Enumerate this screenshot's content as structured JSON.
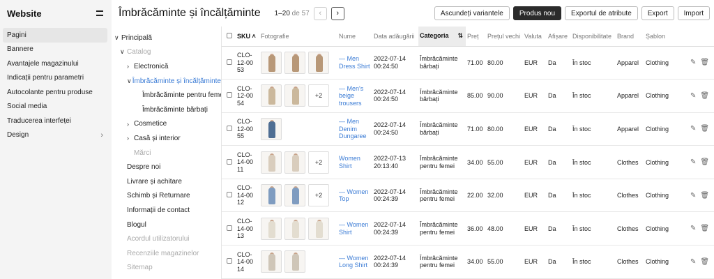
{
  "nav": {
    "title": "Website",
    "items": [
      {
        "label": "Pagini",
        "active": true
      },
      {
        "label": "Bannere"
      },
      {
        "label": "Avantajele magazinului"
      },
      {
        "label": "Indicații pentru parametri"
      },
      {
        "label": "Autocolante pentru produse"
      },
      {
        "label": "Social media"
      },
      {
        "label": "Traducerea interfeței"
      },
      {
        "label": "Design",
        "chevron": "›"
      }
    ]
  },
  "tree": [
    {
      "label": "Principală",
      "arrow": "∨",
      "indent": 0
    },
    {
      "label": "Catalog",
      "arrow": "∨",
      "indent": 1,
      "muted": true
    },
    {
      "label": "Electronică",
      "arrow": "›",
      "indent": 2
    },
    {
      "label": "Îmbrăcăminte și încălțăminte",
      "arrow": "∨",
      "indent": 2,
      "link": true
    },
    {
      "label": "Îmbrăcăminte pentru femei",
      "arrow": "",
      "indent": 3
    },
    {
      "label": "Îmbrăcăminte bărbați",
      "arrow": "",
      "indent": 3
    },
    {
      "label": "Cosmetice",
      "arrow": "›",
      "indent": 2
    },
    {
      "label": "Casă și interior",
      "arrow": "›",
      "indent": 2
    },
    {
      "label": "Mărci",
      "arrow": "",
      "indent": 2,
      "muted": true
    },
    {
      "label": "Despre noi",
      "arrow": "",
      "indent": 1
    },
    {
      "label": "Livrare și achitare",
      "arrow": "",
      "indent": 1
    },
    {
      "label": "Schimb și Returnare",
      "arrow": "",
      "indent": 1
    },
    {
      "label": "Informații de contact",
      "arrow": "",
      "indent": 1
    },
    {
      "label": "Blogul",
      "arrow": "",
      "indent": 1
    },
    {
      "label": "Acordul utilizatorului",
      "arrow": "",
      "indent": 1,
      "muted": true
    },
    {
      "label": "Recenziile magazinelor",
      "arrow": "",
      "indent": 1,
      "muted": true
    },
    {
      "label": "Sitemap",
      "arrow": "",
      "indent": 1,
      "muted": true
    }
  ],
  "header": {
    "title": "Îmbrăcăminte și încălțăminte",
    "range": "1–20",
    "of": "de 57",
    "prev_icon": "chevron-left-icon",
    "next_icon": "chevron-right-icon",
    "buttons": {
      "hide_variants": "Ascundeți variantele",
      "new_product": "Produs nou",
      "export_attributes": "Exportul de atribute",
      "export": "Export",
      "import": "Import"
    }
  },
  "table": {
    "columns": {
      "sku": "SKU",
      "photo": "Fotografie",
      "name": "Nume",
      "date": "Data adăugării",
      "category": "Categoria",
      "price": "Preț",
      "old_price": "Prețul vechi",
      "currency": "Valuta",
      "display": "Afișare",
      "availability": "Disponibilitate",
      "brand": "Brand",
      "template": "Șablon"
    },
    "rows": [
      {
        "sku": "CLO-12-0053",
        "photos": 3,
        "more": "",
        "name": "— Men Dress Shirt",
        "date": "2022-07-14",
        "time": "00:24:50",
        "cat1": "Îmbrăcăminte",
        "cat2": "bărbați",
        "price": "71.00",
        "old": "80.00",
        "cur": "EUR",
        "disp": "Da",
        "avail": "În stoc",
        "brand": "Apparel",
        "tpl": "Clothing",
        "col": "#b89878"
      },
      {
        "sku": "CLO-12-0054",
        "photos": 2,
        "more": "+2",
        "name": "— Men's beige trousers",
        "date": "2022-07-14",
        "time": "00:24:50",
        "cat1": "Îmbrăcăminte",
        "cat2": "bărbați",
        "price": "85.00",
        "old": "90.00",
        "cur": "EUR",
        "disp": "Da",
        "avail": "În stoc",
        "brand": "Apparel",
        "tpl": "Clothing",
        "col": "#cbb89c"
      },
      {
        "sku": "CLO-12-0055",
        "photos": 1,
        "more": "",
        "name": "— Men Denim Dungaree",
        "date": "2022-07-14",
        "time": "00:24:50",
        "cat1": "Îmbrăcăminte",
        "cat2": "bărbați",
        "price": "71.00",
        "old": "80.00",
        "cur": "EUR",
        "disp": "Da",
        "avail": "În stoc",
        "brand": "Apparel",
        "tpl": "Clothing",
        "col": "#4f6e93"
      },
      {
        "sku": "CLO-14-0011",
        "photos": 2,
        "more": "+2",
        "name": "Women Shirt",
        "date": "2022-07-13",
        "time": "20:13:40",
        "cat1": "Îmbrăcăminte",
        "cat2": "pentru femei",
        "price": "34.00",
        "old": "55.00",
        "cur": "EUR",
        "disp": "Da",
        "avail": "În stoc",
        "brand": "Clothes",
        "tpl": "Clothing",
        "col": "#d9cdbd"
      },
      {
        "sku": "CLO-14-0012",
        "photos": 2,
        "more": "+2",
        "name": "— Women Top",
        "date": "2022-07-14",
        "time": "00:24:39",
        "cat1": "Îmbrăcăminte",
        "cat2": "pentru femei",
        "price": "22.00",
        "old": "32.00",
        "cur": "EUR",
        "disp": "Da",
        "avail": "În stoc",
        "brand": "Clothes",
        "tpl": "Clothing",
        "col": "#7f9cc0"
      },
      {
        "sku": "CLO-14-0013",
        "photos": 3,
        "more": "",
        "name": "— Women Shirt",
        "date": "2022-07-14",
        "time": "00:24:39",
        "cat1": "Îmbrăcăminte",
        "cat2": "pentru femei",
        "price": "36.00",
        "old": "48.00",
        "cur": "EUR",
        "disp": "Da",
        "avail": "În stoc",
        "brand": "Clothes",
        "tpl": "Clothing",
        "col": "#e3ddd0"
      },
      {
        "sku": "CLO-14-0014",
        "photos": 2,
        "more": "",
        "name": "— Women Long Shirt",
        "date": "2022-07-14",
        "time": "00:24:39",
        "cat1": "Îmbrăcăminte",
        "cat2": "pentru femei",
        "price": "34.00",
        "old": "55.00",
        "cur": "EUR",
        "disp": "Da",
        "avail": "În stoc",
        "brand": "Clothes",
        "tpl": "Clothing",
        "col": "#cfc6b8"
      }
    ]
  },
  "icons": {
    "edit": "pencil-icon",
    "delete": "trash-icon",
    "sort": "sort-icon"
  }
}
